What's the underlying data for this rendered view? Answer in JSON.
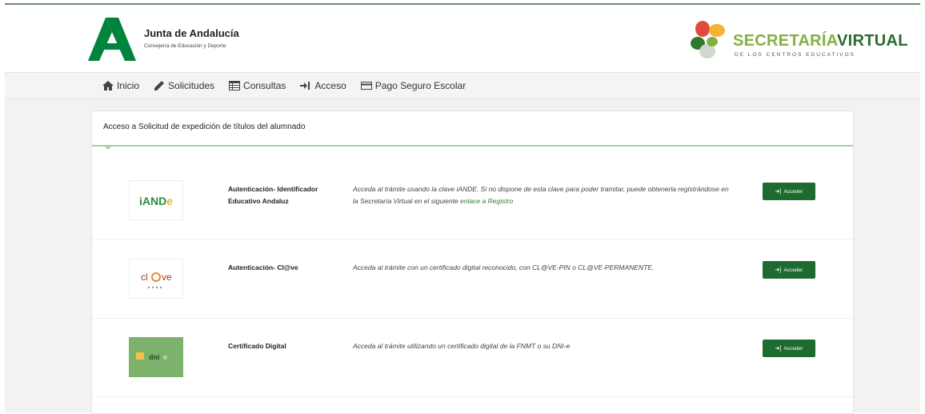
{
  "header": {
    "org_name": "Junta de Andalucía",
    "org_sub": "Consejería de Educación y Deporte",
    "portal_title_light": "SECRETARÍA",
    "portal_title_strong": "VIRTUAL",
    "portal_sub": "DE LOS CENTROS EDUCATIVOS"
  },
  "nav": {
    "items": [
      {
        "label": "Inicio",
        "icon": "home-icon"
      },
      {
        "label": "Solicitudes",
        "icon": "pencil-icon"
      },
      {
        "label": "Consultas",
        "icon": "table-icon"
      },
      {
        "label": "Acceso",
        "icon": "sign-in-icon"
      },
      {
        "label": "Pago Seguro Escolar",
        "icon": "credit-card-icon"
      }
    ]
  },
  "card": {
    "title": "Acceso a Solicitud de expedición de títulos del alumnado"
  },
  "methods": [
    {
      "logo_text": "iANDe",
      "name": "Autenticación- Identificador Educativo Andaluz",
      "desc": "Acceda al trámite usando la clave iANDE. Si no dispone de esta clave para poder tramitar, puede obtenerla registrándose en la Secretaría Virtual en el siguiente ",
      "link": "enlace a Registro",
      "button": "Acceder"
    },
    {
      "logo_text": "cl@ve",
      "name": "Autenticación- Cl@ve",
      "desc": "Acceda al trámite con un certificado digital reconocido, con CL@VE-PIN o CL@VE-PERMANENTE.",
      "button": "Acceder"
    },
    {
      "logo_text": "dni e",
      "name": "Certificado Digital",
      "desc": "Acceda al trámite utilizando un certificado digital de la FNMT o su DNI-e",
      "button": "Acceder"
    }
  ],
  "colors": {
    "brand_green": "#00843d",
    "button_green": "#1e6b2f",
    "link_green": "#2e7d32"
  }
}
